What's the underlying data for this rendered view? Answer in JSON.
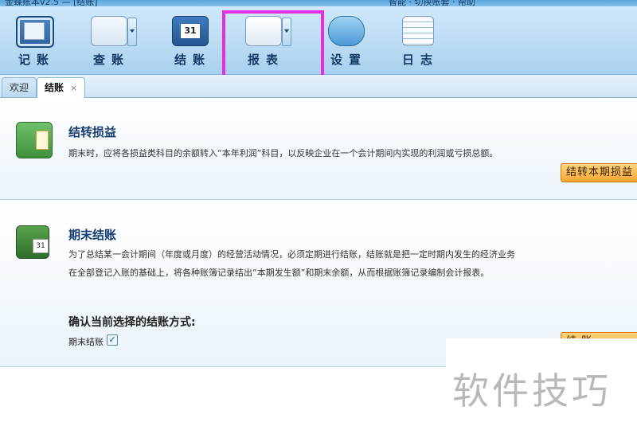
{
  "app": {
    "title_partial": "金蝶账本v2.5 — [结账]",
    "top_right_partial": "智能 · 切换账套 · 帮助"
  },
  "toolbar": {
    "items": [
      {
        "label": "记账",
        "icon": "ledger-book-icon"
      },
      {
        "label": "查账",
        "icon": "magnifier-ledger-icon"
      },
      {
        "label": "结账",
        "icon": "calendar-icon",
        "calendar_number": "31"
      },
      {
        "label": "报表",
        "icon": "chart-report-icon"
      },
      {
        "label": "设置",
        "icon": "gear-icon"
      },
      {
        "label": "日志",
        "icon": "log-lines-icon"
      }
    ],
    "highlight_color": "#e62ee0"
  },
  "tabs": {
    "welcome": "欢迎",
    "close_period": "结账",
    "close_symbol": "×"
  },
  "carry_forward": {
    "title": "结转损益",
    "description": "期末时，应将各损益类科目的余额转入“本年利润”科目，以反映企业在一个会计期间内实现的利润或亏损总额。",
    "button": "结转本期损益"
  },
  "period_close": {
    "title": "期末结账",
    "description": "为了总结某一会计期间（年度或月度）的经营活动情况，必须定期进行结账，结账就是把一定时期内发生的经济业务在全部登记入账的基础上，将各种账簿记录结出“本期发生额”和期末余额，从而根据账簿记录编制会计报表。",
    "confirm_title": "确认当前选择的结账方式:",
    "checkbox_label": "期末结账",
    "checkbox_mark": "✓",
    "button": "结 账"
  },
  "watermark": "软件技巧",
  "colors": {
    "accent_orange": "#f6a632",
    "title_blue": "#173e72"
  }
}
